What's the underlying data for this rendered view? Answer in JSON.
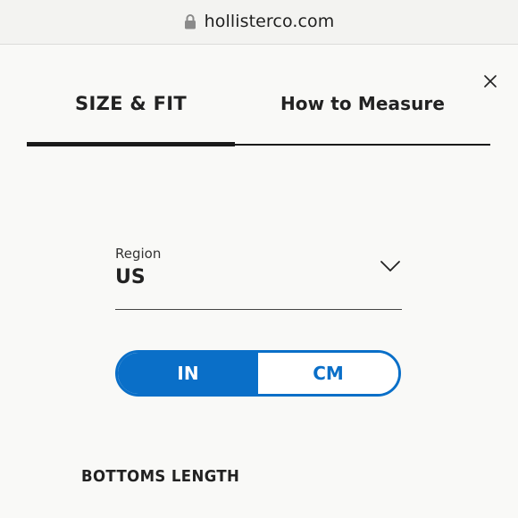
{
  "browser": {
    "url": "hollisterco.com",
    "icons": {
      "lock": "lock-icon"
    }
  },
  "modal": {
    "close_icon": "close-icon",
    "tabs": [
      {
        "label": "SIZE & FIT",
        "active": true
      },
      {
        "label": "How to Measure",
        "active": false
      }
    ],
    "region": {
      "label": "Region",
      "value": "US",
      "icon": "chevron-down-icon"
    },
    "units": {
      "options": [
        "IN",
        "CM"
      ],
      "selected": "IN"
    },
    "section_heading": "BOTTOMS LENGTH"
  },
  "colors": {
    "accent": "#0a6fc8",
    "text": "#222222",
    "background": "#f9f9f7"
  }
}
